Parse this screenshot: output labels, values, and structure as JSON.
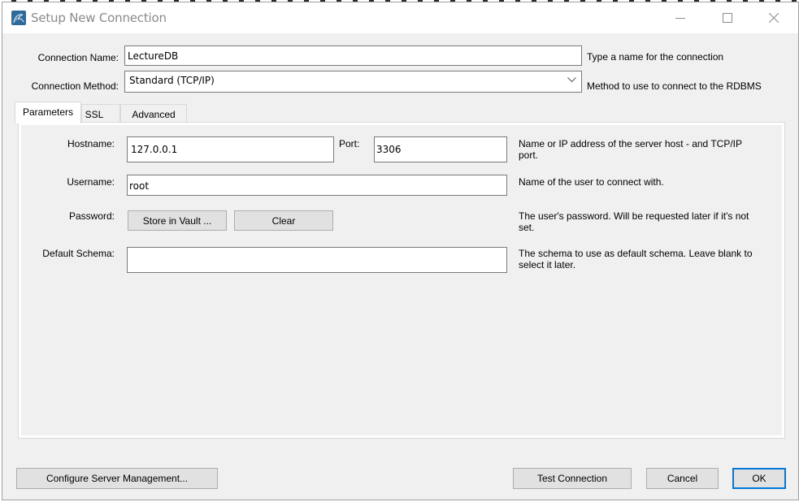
{
  "window": {
    "title": "Setup New Connection",
    "icon": "mysql-workbench-dolphin-icon",
    "controls": {
      "minimize": "minimize-icon",
      "maximize": "maximize-icon",
      "close": "close-icon"
    }
  },
  "connection": {
    "name_label": "Connection Name:",
    "name_value": "LectureDB",
    "name_hint": "Type a name for the connection",
    "method_label": "Connection Method:",
    "method_value": "Standard (TCP/IP)",
    "method_hint": "Method to use to connect to the RDBMS"
  },
  "tabs": [
    {
      "label": "Parameters",
      "active": true
    },
    {
      "label": "SSL",
      "active": false
    },
    {
      "label": "Advanced",
      "active": false
    }
  ],
  "parameters": {
    "hostname_label": "Hostname:",
    "hostname_value": "127.0.0.1",
    "port_label": "Port:",
    "port_value": "3306",
    "hostname_hint": "Name or IP address of the server host - and TCP/IP port.",
    "username_label": "Username:",
    "username_value": "root",
    "username_hint": "Name of the user to connect with.",
    "password_label": "Password:",
    "store_vault_label": "Store in Vault ...",
    "clear_label": "Clear",
    "password_hint": "The user's password. Will be requested later if it's not set.",
    "schema_label": "Default Schema:",
    "schema_value": "",
    "schema_hint": "The schema to use as default schema. Leave blank to select it later."
  },
  "footer": {
    "configure_label": "Configure Server Management...",
    "test_label": "Test Connection",
    "cancel_label": "Cancel",
    "ok_label": "OK"
  },
  "colors": {
    "accent": "#0078d7",
    "icon_bg": "#2e6a9a",
    "dialog_bg": "#f0f0f0"
  }
}
